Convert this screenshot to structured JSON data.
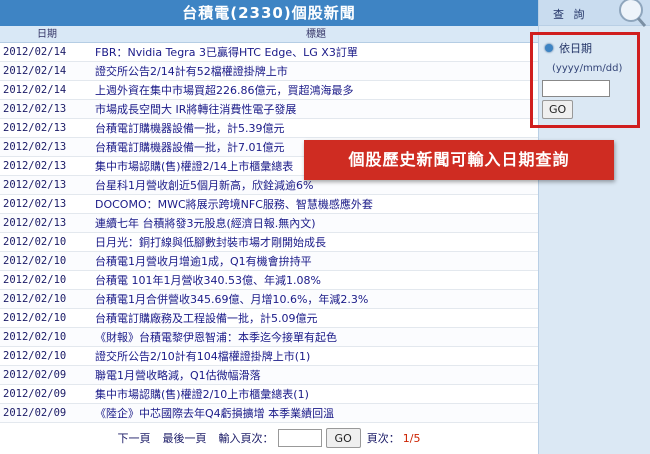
{
  "header": {
    "title": "台積電(2330)個股新聞"
  },
  "columns": {
    "date": "日期",
    "title": "標題"
  },
  "news": [
    {
      "date": "2012/02/14",
      "title": "FBR：Nvidia Tegra 3已贏得HTC Edge、LG X3訂單"
    },
    {
      "date": "2012/02/14",
      "title": "證交所公告2/14計有52檔權證掛牌上市"
    },
    {
      "date": "2012/02/14",
      "title": "上週外資在集中市場買超226.86億元，買超鴻海最多"
    },
    {
      "date": "2012/02/13",
      "title": "市場成長空間大 IR將轉往消費性電子發展"
    },
    {
      "date": "2012/02/13",
      "title": "台積電訂購機器設備一批，計5.39億元"
    },
    {
      "date": "2012/02/13",
      "title": "台積電訂購機器設備一批，計7.01億元"
    },
    {
      "date": "2012/02/13",
      "title": "集中市場認購(售)權證2/14上市櫃彙總表"
    },
    {
      "date": "2012/02/13",
      "title": "台星科1月營收創近5個月新高，欣銓減逾6%"
    },
    {
      "date": "2012/02/13",
      "title": "DOCOMO：MWC將展示跨境NFC服務、智慧機感應外套"
    },
    {
      "date": "2012/02/13",
      "title": "連續七年 台積將發3元股息(經濟日報.無內文)"
    },
    {
      "date": "2012/02/10",
      "title": "日月光：銅打線與低腳數封裝市場才剛開始成長"
    },
    {
      "date": "2012/02/10",
      "title": "台積電1月營收月增逾1成，Q1有機會拚持平"
    },
    {
      "date": "2012/02/10",
      "title": "台積電 101年1月營收340.53億、年減1.08%"
    },
    {
      "date": "2012/02/10",
      "title": "台積電1月合併營收345.69億、月增10.6%，年減2.3%"
    },
    {
      "date": "2012/02/10",
      "title": "台積電訂購廠務及工程設備一批，計5.09億元"
    },
    {
      "date": "2012/02/10",
      "title": "《財報》台積電黎伊恩智浦：本季迄今接單有起色"
    },
    {
      "date": "2012/02/10",
      "title": "證交所公告2/10計有104檔權證掛牌上市(1)"
    },
    {
      "date": "2012/02/09",
      "title": "聯電1月營收略減，Q1估微幅滑落"
    },
    {
      "date": "2012/02/09",
      "title": "集中市場認購(售)權證2/10上市櫃彙總表(1)"
    },
    {
      "date": "2012/02/09",
      "title": "《陸企》中芯國際去年Q4虧損擴增 本季業績回溫"
    }
  ],
  "pager": {
    "next": "下一頁",
    "last": "最後一頁",
    "input_label": "輸入頁次：",
    "go": "GO",
    "count_label": "頁次：",
    "count": "1/5"
  },
  "sidebar": {
    "title": "查 詢",
    "date_label": "依日期",
    "date_format": "(yyyy/mm/dd)",
    "go": "GO"
  },
  "callout": {
    "text": "個股歷史新聞可輸入日期查詢"
  },
  "colors": {
    "title_bar": "#3e84c4",
    "sidebar_bg": "#dbe8f4",
    "highlight": "#d01e1e"
  }
}
